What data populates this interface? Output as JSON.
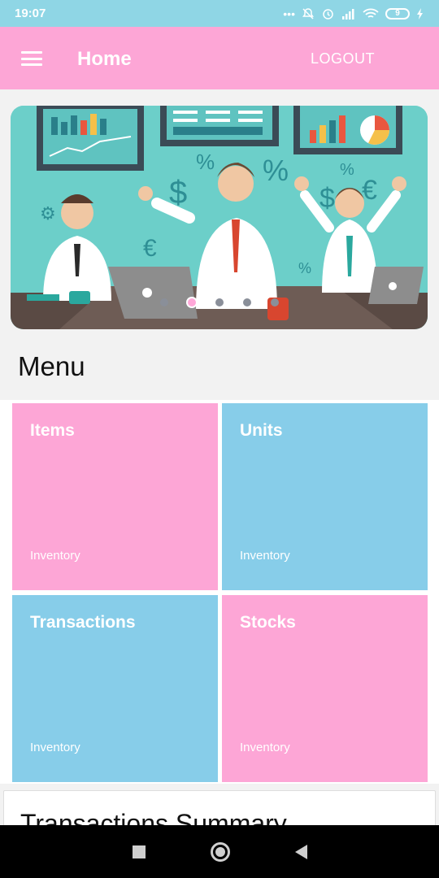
{
  "status_bar": {
    "time": "19:07",
    "icons": [
      "more-dots-icon",
      "bell-off-icon",
      "alarm-icon",
      "signal-icon",
      "wifi-icon",
      "battery-icon",
      "charging-icon"
    ],
    "battery_level": "9"
  },
  "app_bar": {
    "title": "Home",
    "logout_label": "LOGOUT",
    "background_color": "#fda6d6"
  },
  "banner": {
    "icon": "office-team-illustration",
    "carousel_total": 5,
    "carousel_active_index": 1
  },
  "menu": {
    "title": "Menu",
    "tiles": [
      {
        "title": "Items",
        "subtitle": "Inventory",
        "color": "#fda6d6"
      },
      {
        "title": "Units",
        "subtitle": "Inventory",
        "color": "#87cde9"
      },
      {
        "title": "Transactions",
        "subtitle": "Inventory",
        "color": "#87cde9"
      },
      {
        "title": "Stocks",
        "subtitle": "Inventory",
        "color": "#fda6d6"
      }
    ]
  },
  "summary": {
    "title": "Transactions Summary"
  },
  "nav_bar": {
    "icons": [
      "recents-square-icon",
      "home-circle-icon",
      "back-triangle-icon"
    ]
  }
}
